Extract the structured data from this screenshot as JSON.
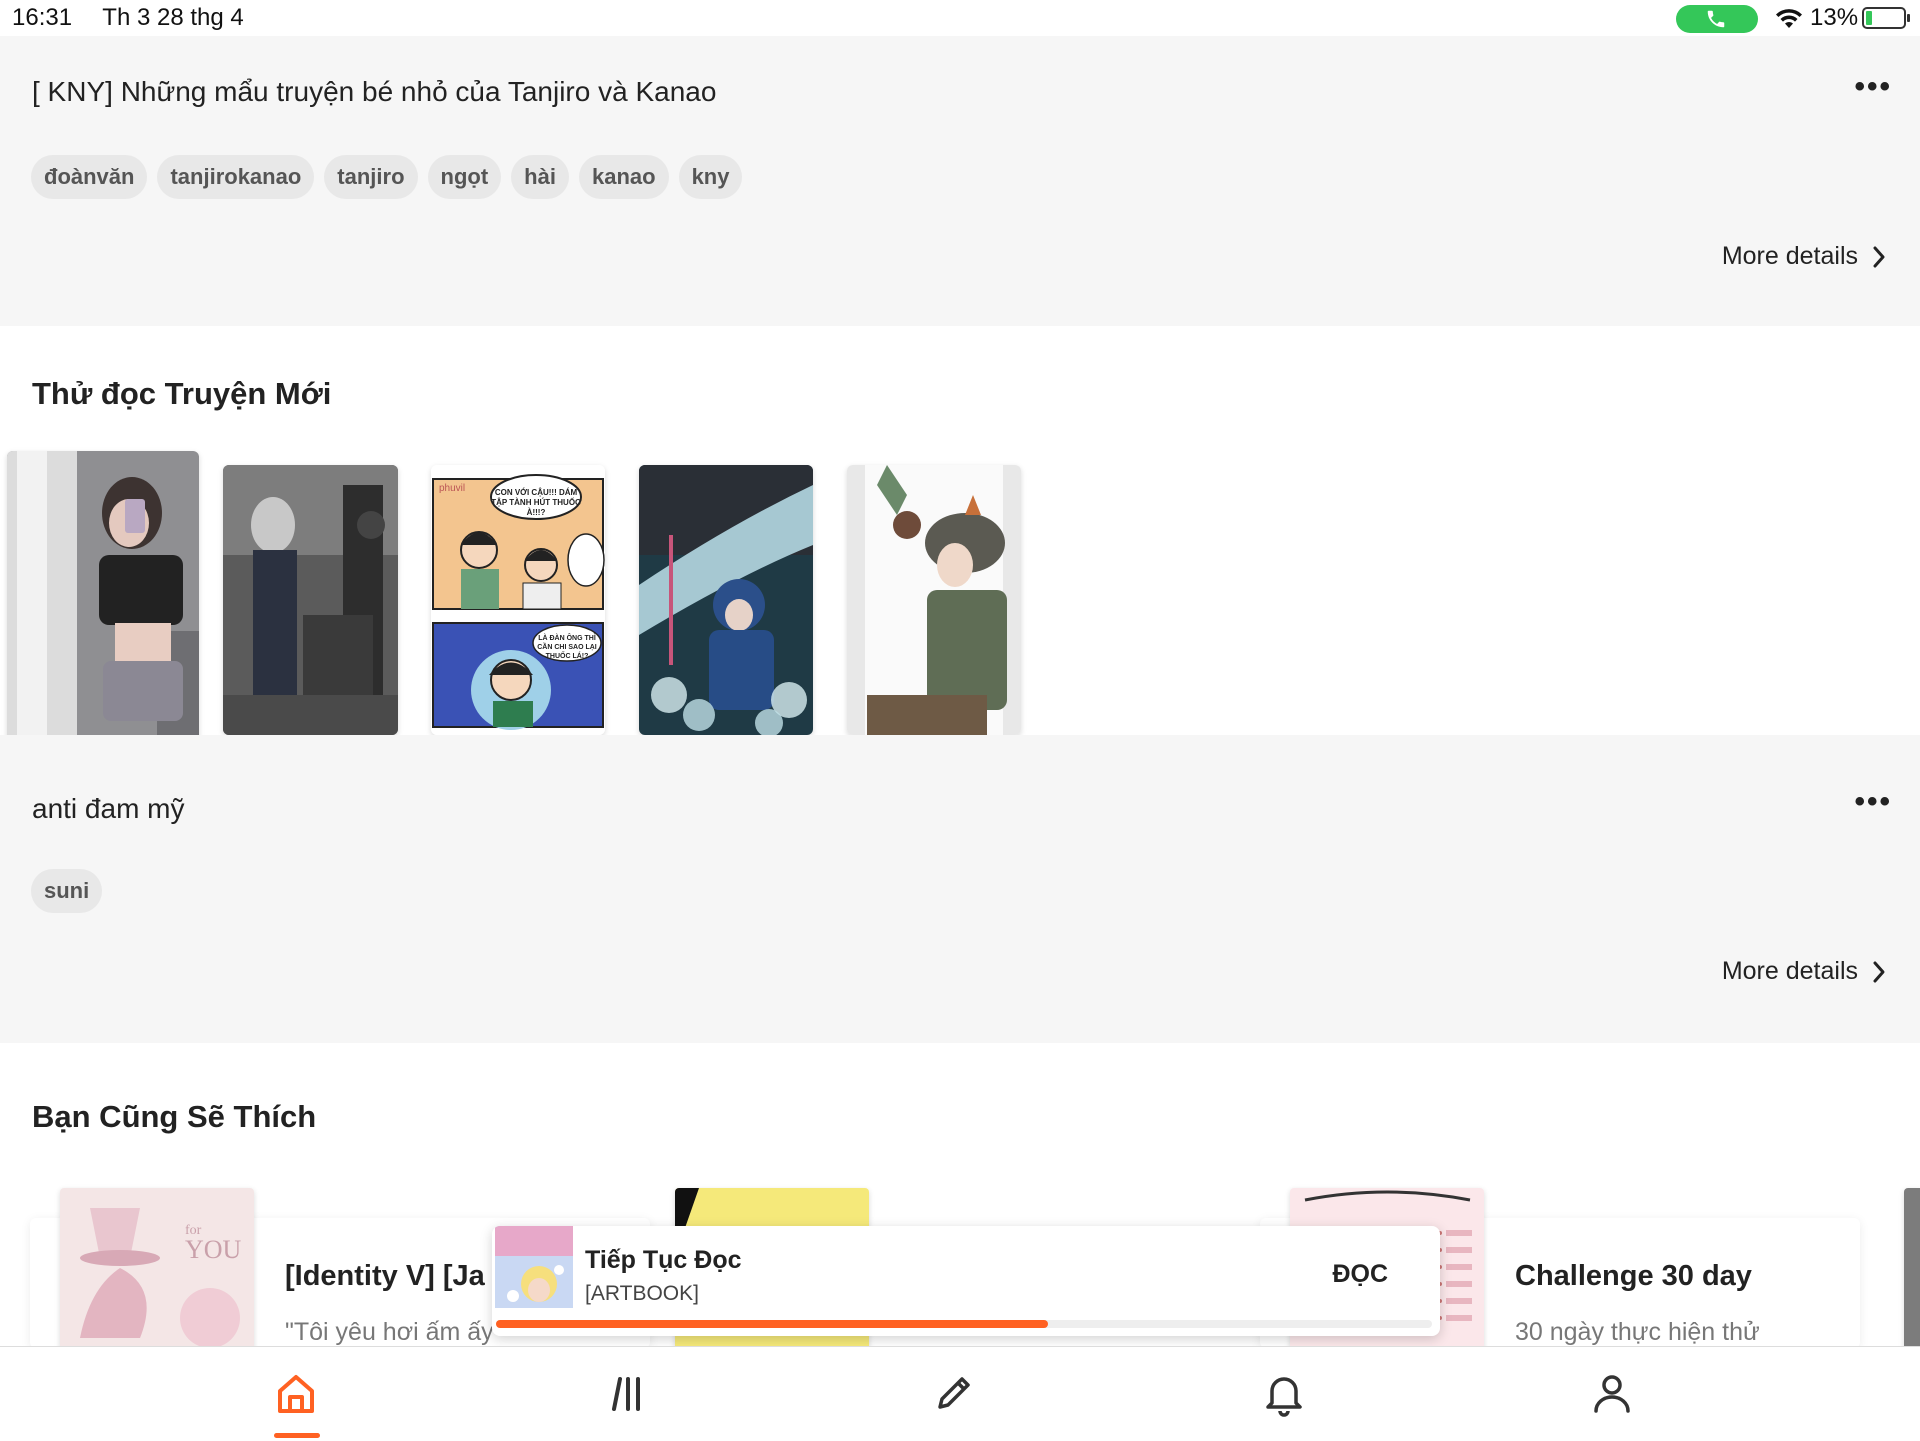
{
  "status_bar": {
    "time": "16:31",
    "date": "Th 3 28 thg 4",
    "battery": "13%"
  },
  "story1": {
    "title": "[ KNY] Những mẩu truyện bé nhỏ của Tanjiro và Kanao",
    "tags": [
      "đoànvăn",
      "tanjirokanao",
      "tanjiro",
      "ngọt",
      "hài",
      "kanao",
      "kny"
    ],
    "more_label": "More details"
  },
  "new_stories": {
    "title": "Thử đọc Truyện Mới"
  },
  "story2": {
    "title": "anti đam mỹ",
    "tags": [
      "suni"
    ],
    "more_label": "More details"
  },
  "recommend": {
    "title": "Bạn Cũng Sẽ Thích",
    "cards": [
      {
        "title": "[Identity V] [Ja",
        "desc": "\"Tôi yêu hơi ấm ấy"
      },
      {
        "title": "Challenge 30 day",
        "desc": "30 ngày thực hiện thử"
      }
    ]
  },
  "continue_reading": {
    "title": "Tiếp Tục Đọc",
    "subtitle": "[ARTBOOK]",
    "button": "ĐỌC",
    "progress": 0.59
  },
  "tabs": [
    "home-icon",
    "library-icon",
    "write-icon",
    "notifications-icon",
    "profile-icon"
  ],
  "colors": {
    "accent": "#ff6122",
    "call": "#34c759"
  }
}
